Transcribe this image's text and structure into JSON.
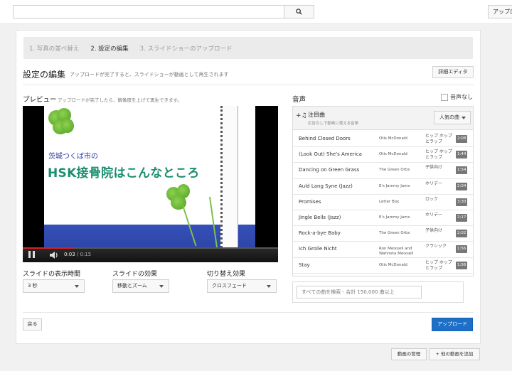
{
  "topbar": {
    "search_placeholder": "",
    "upload_label": "アップロ"
  },
  "steps": [
    {
      "label": "1. 写真の並べ替え",
      "active": false
    },
    {
      "label": "2. 設定の編集",
      "active": true
    },
    {
      "label": "3. スライドショーのアップロード",
      "active": false
    }
  ],
  "section": {
    "title": "設定の編集",
    "subtitle": "アップロードが完了すると、スライドショーが動画として再生されます",
    "detail_editor_label": "詳細エディタ"
  },
  "preview": {
    "title": "プレビュー",
    "subtitle": "アップロードが完了したら、解像度を上げて再生できます。",
    "slide_subtitle": "茨城つくば市の",
    "slide_title": "HSK接骨院はこんなところ",
    "time_current": "0:03",
    "time_total": " / 0:15",
    "progress_fraction": 0.2
  },
  "options": {
    "duration_label": "スライドの表示時間",
    "duration_value": "3 秒",
    "effect_label": "スライドの効果",
    "effect_value": "移動とズーム",
    "transition_label": "切り替え効果",
    "transition_value": "クロスフェード"
  },
  "audio": {
    "title": "音声",
    "no_audio_label": "音声なし",
    "featured_title": "注目曲",
    "featured_sub": "広告なしで動画に使える音楽",
    "popular_label": "人気の曲",
    "tracks": [
      {
        "title": "Behind Closed Doors",
        "artist": "Otis McDonald",
        "genre": "ヒップ ホップとラップ",
        "time": "2:08"
      },
      {
        "title": "(Look Out) She's America",
        "artist": "Otis McDonald",
        "genre": "ヒップ ホップとラップ",
        "time": "1:44"
      },
      {
        "title": "Dancing on Green Grass",
        "artist": "The Green Orbs",
        "genre": "子供向け",
        "time": "1:54"
      },
      {
        "title": "Auld Lang Syne (Jazz)",
        "artist": "E's Jammy Jams",
        "genre": "ホリデー",
        "time": "2:04"
      },
      {
        "title": "Promises",
        "artist": "Letter Box",
        "genre": "ロック",
        "time": "3:30"
      },
      {
        "title": "Jingle Bells (Jazz)",
        "artist": "E's Jammy Jams",
        "genre": "ホリデー",
        "time": "2:17"
      },
      {
        "title": "Rock-a-bye Baby",
        "artist": "The Green Orbs",
        "genre": "子供向け",
        "time": "2:02"
      },
      {
        "title": "Ich Grolle Nicht",
        "artist": "Ron Meixsell and Wahneta Meixsell",
        "genre": "クラシック",
        "time": "1:56"
      },
      {
        "title": "Stay",
        "artist": "Otis McDonald",
        "genre": "ヒップ ホップとラップ",
        "time": "1:56"
      }
    ],
    "search_placeholder": "すべての曲を検索 - 合計 150,000 曲以上"
  },
  "footer": {
    "back_label": "戻る",
    "upload_label": "アップロード",
    "manage_label": "動画の管理",
    "add_video_label": "+ 他の動画を追加"
  },
  "colors": {
    "primary_button": "#1d6fc8",
    "progress": "#d52020",
    "slide_title": "#1a8f70",
    "slide_subtitle": "#2e3d9e"
  }
}
